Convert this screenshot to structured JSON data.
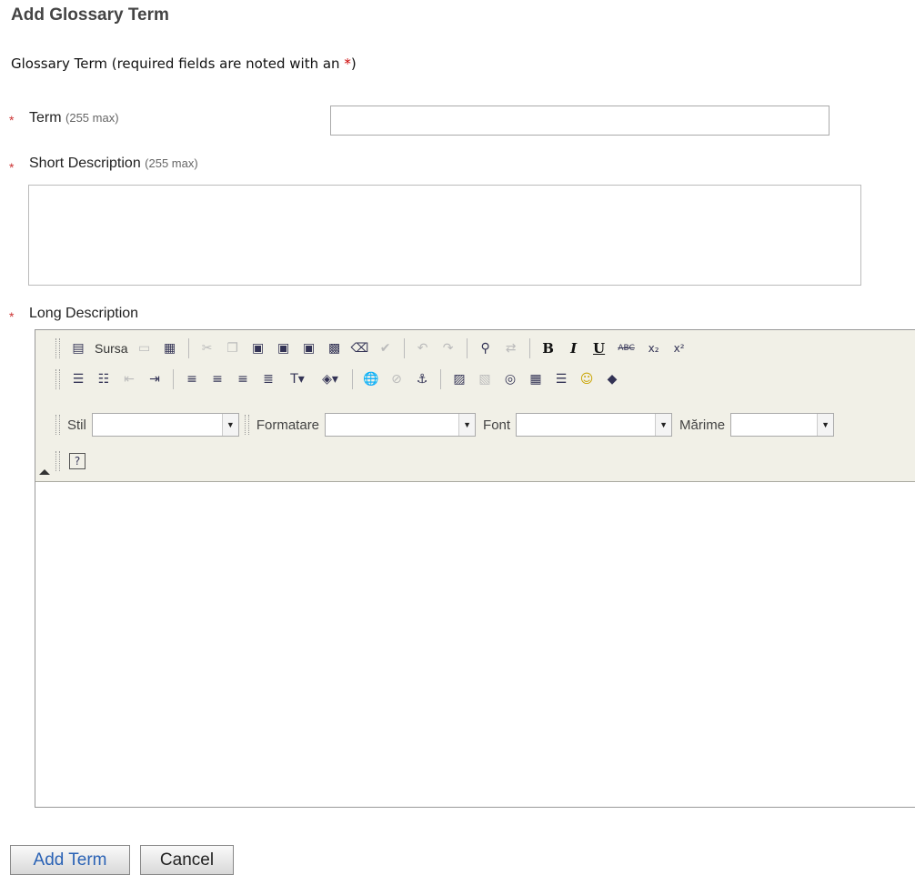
{
  "page": {
    "title": "Add Glossary Term",
    "subtitle_prefix": "Glossary Term (required fields are noted with an ",
    "subtitle_asterisk": "*",
    "subtitle_suffix": ")"
  },
  "fields": {
    "term": {
      "required": "*",
      "label": "Term",
      "hint": "(255 max)",
      "value": ""
    },
    "short_description": {
      "required": "*",
      "label": "Short Description",
      "hint": "(255 max)",
      "value": ""
    },
    "long_description": {
      "required": "*",
      "label": "Long Description",
      "value": ""
    }
  },
  "editor": {
    "source_label": "Sursa",
    "combos": [
      {
        "label": "Stil",
        "value": ""
      },
      {
        "label": "Formatare",
        "value": ""
      },
      {
        "label": "Font",
        "value": ""
      },
      {
        "label": "Mărime",
        "value": ""
      }
    ],
    "buttons": {
      "bold": "B",
      "italic": "I",
      "underline": "U",
      "strike": "ABC",
      "subscript": "x₂",
      "superscript": "x²",
      "help": "?"
    }
  },
  "actions": {
    "add_label": "Add Term",
    "cancel_label": "Cancel"
  },
  "colors": {
    "required": "#cc3333",
    "toolbar": "#f1f0e7",
    "primary_button_text": "#2a62b5"
  }
}
